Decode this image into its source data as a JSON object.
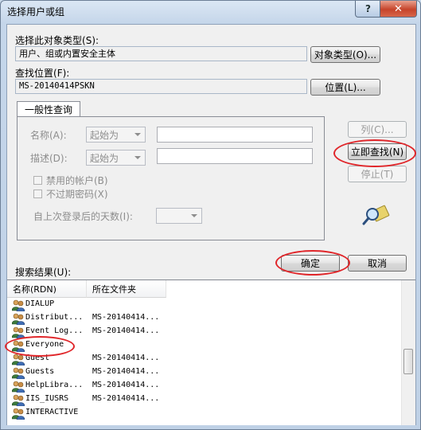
{
  "window": {
    "title": "选择用户或组",
    "help_glyph": "?",
    "close_glyph": "✕"
  },
  "object_type": {
    "label": "选择此对象类型",
    "hotkey": "(S):",
    "value": "用户、组或内置安全主体",
    "button": "对象类型(O)..."
  },
  "location": {
    "label": "查找位置",
    "hotkey": "(F):",
    "value": "MS-20140414PSKN",
    "button": "位置(L)..."
  },
  "tab": {
    "label": "一般性查询"
  },
  "query": {
    "name_label": "名称(A):",
    "name_mode": "起始为",
    "desc_label": "描述(D):",
    "desc_mode": "起始为",
    "disabled_accounts": "禁用的帐户(B)",
    "no_expire_pwd": "不过期密码(X)",
    "days_label": "自上次登录后的天数(I):"
  },
  "side_buttons": {
    "columns": "列(C)...",
    "find_now": "立即查找(N)",
    "stop": "停止(T)"
  },
  "results_label": "搜索结果(U):",
  "ok_button": "确定",
  "cancel_button": "取消",
  "table": {
    "headers": [
      "名称(RDN)",
      "所在文件夹"
    ],
    "rows": [
      {
        "name": "DIALUP",
        "folder": ""
      },
      {
        "name": "Distribut...",
        "folder": "MS-20140414..."
      },
      {
        "name": "Event Log...",
        "folder": "MS-20140414..."
      },
      {
        "name": "Everyone",
        "folder": ""
      },
      {
        "name": "Guest",
        "folder": "MS-20140414..."
      },
      {
        "name": "Guests",
        "folder": "MS-20140414..."
      },
      {
        "name": "HelpLibra...",
        "folder": "MS-20140414..."
      },
      {
        "name": "IIS_IUSRS",
        "folder": "MS-20140414..."
      },
      {
        "name": "INTERACTIVE",
        "folder": ""
      }
    ]
  },
  "colors": {
    "annotation": "#e0262a",
    "titlebar": "#c5d6ea",
    "close": "#c6442b"
  }
}
